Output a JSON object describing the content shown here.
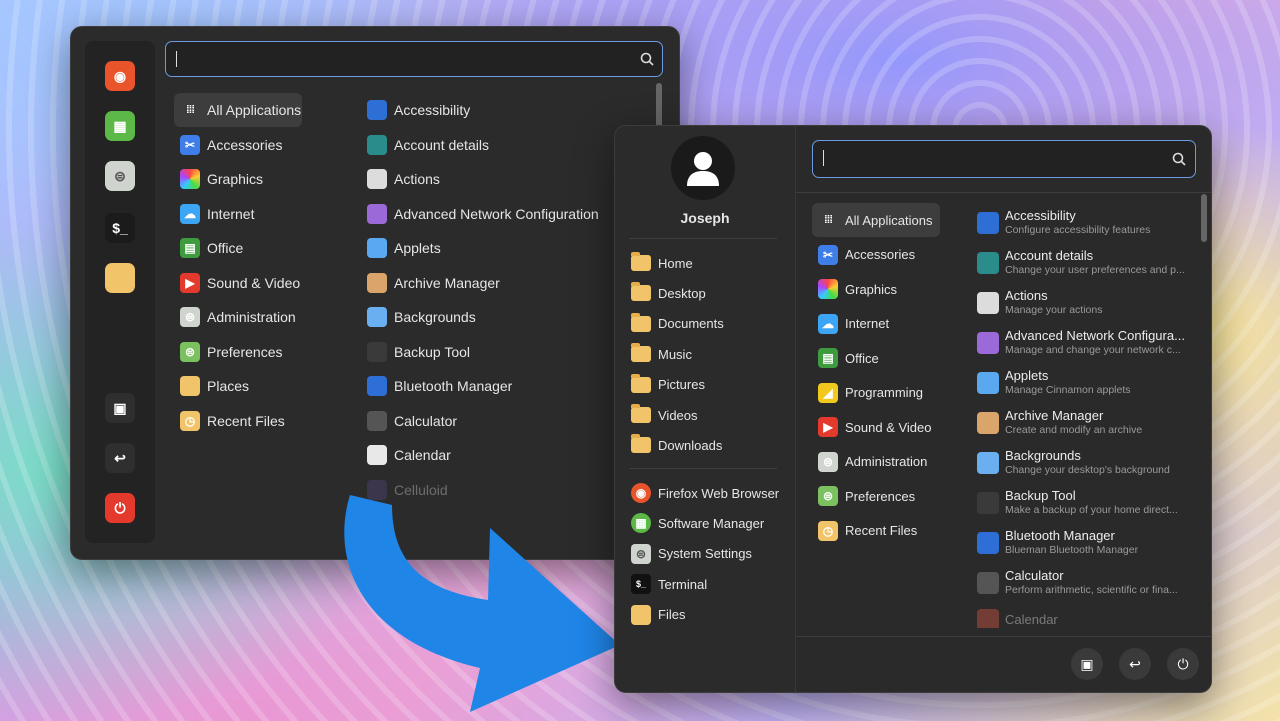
{
  "left_window": {
    "search": {
      "placeholder": ""
    },
    "dock": [
      {
        "name": "firefox-icon",
        "color": "#e9542a"
      },
      {
        "name": "software-manager-icon",
        "color": "#5cb947"
      },
      {
        "name": "settings-toggle-icon",
        "color": "#cfd4cf"
      },
      {
        "name": "terminal-icon",
        "color": "#1b1b1b"
      },
      {
        "name": "folder-icon",
        "color": "#f2c46a"
      },
      {
        "name": "lock-icon",
        "color": "#2f2f2f"
      },
      {
        "name": "logout-icon",
        "color": "#2f2f2f"
      },
      {
        "name": "power-icon",
        "color": "#e33a2d"
      }
    ],
    "categories": [
      {
        "label": "All Applications",
        "icon": "grid-icon"
      },
      {
        "label": "Accessories",
        "icon": "scissors-icon",
        "color": "#3f7ee8"
      },
      {
        "label": "Graphics",
        "icon": "palette-icon",
        "color": "#c94fd8"
      },
      {
        "label": "Internet",
        "icon": "cloud-icon",
        "color": "#3da5f5"
      },
      {
        "label": "Office",
        "icon": "office-icon",
        "color": "#3e9b3e"
      },
      {
        "label": "Sound & Video",
        "icon": "play-icon",
        "color": "#e33a2d"
      },
      {
        "label": "Administration",
        "icon": "toggle-icon",
        "color": "#cfd4cf"
      },
      {
        "label": "Preferences",
        "icon": "preferences-icon",
        "color": "#7cc160"
      },
      {
        "label": "Places",
        "icon": "folder-icon",
        "color": "#f2c46a"
      },
      {
        "label": "Recent Files",
        "icon": "recent-icon",
        "color": "#f2c46a"
      }
    ],
    "apps": [
      {
        "label": "Accessibility",
        "color": "#2e6fd6"
      },
      {
        "label": "Account details",
        "color": "#2b8c8c"
      },
      {
        "label": "Actions",
        "color": "#dcdcdc"
      },
      {
        "label": "Advanced Network Configuration",
        "color": "#9c6ad8"
      },
      {
        "label": "Applets",
        "color": "#5aa8f0"
      },
      {
        "label": "Archive Manager",
        "color": "#d9a56b"
      },
      {
        "label": "Backgrounds",
        "color": "#6ab0f0"
      },
      {
        "label": "Backup Tool",
        "color": "#3a3a3a"
      },
      {
        "label": "Bluetooth Manager",
        "color": "#2d6fd6"
      },
      {
        "label": "Calculator",
        "color": "#555555"
      },
      {
        "label": "Calendar",
        "color": "#e8e8e8"
      },
      {
        "label": "Celluloid",
        "color": "#5a4a8a"
      }
    ]
  },
  "right_window": {
    "user_name": "Joseph",
    "search": {
      "placeholder": ""
    },
    "places": [
      {
        "label": "Home"
      },
      {
        "label": "Desktop"
      },
      {
        "label": "Documents"
      },
      {
        "label": "Music"
      },
      {
        "label": "Pictures"
      },
      {
        "label": "Videos"
      },
      {
        "label": "Downloads"
      }
    ],
    "favorites": [
      {
        "label": "Firefox Web Browser",
        "icon": "firefox-icon",
        "color": "#e9542a"
      },
      {
        "label": "Software Manager",
        "icon": "software-manager-icon",
        "color": "#5cb947"
      },
      {
        "label": "System Settings",
        "icon": "settings-icon",
        "color": "#cfd4cf"
      },
      {
        "label": "Terminal",
        "icon": "terminal-icon",
        "color": "#111111"
      },
      {
        "label": "Files",
        "icon": "folder-icon",
        "color": "#f2c46a"
      }
    ],
    "categories": [
      {
        "label": "All Applications",
        "icon": "grid-icon"
      },
      {
        "label": "Accessories",
        "icon": "scissors-icon",
        "color": "#3f7ee8"
      },
      {
        "label": "Graphics",
        "icon": "palette-icon",
        "color": "#c94fd8"
      },
      {
        "label": "Internet",
        "icon": "cloud-icon",
        "color": "#3da5f5"
      },
      {
        "label": "Office",
        "icon": "office-icon",
        "color": "#3e9b3e"
      },
      {
        "label": "Programming",
        "icon": "programming-icon",
        "color": "#f2c81e"
      },
      {
        "label": "Sound & Video",
        "icon": "play-icon",
        "color": "#e33a2d"
      },
      {
        "label": "Administration",
        "icon": "toggle-icon",
        "color": "#cfd4cf"
      },
      {
        "label": "Preferences",
        "icon": "preferences-icon",
        "color": "#7cc160"
      },
      {
        "label": "Recent Files",
        "icon": "recent-icon",
        "color": "#f2c46a"
      }
    ],
    "apps": [
      {
        "label": "Accessibility",
        "desc": "Configure accessibility features",
        "color": "#2e6fd6"
      },
      {
        "label": "Account details",
        "desc": "Change your user preferences and p...",
        "color": "#2b8c8c"
      },
      {
        "label": "Actions",
        "desc": "Manage your actions",
        "color": "#dcdcdc"
      },
      {
        "label": "Advanced Network Configura...",
        "desc": "Manage and change your network c...",
        "color": "#9c6ad8"
      },
      {
        "label": "Applets",
        "desc": "Manage Cinnamon applets",
        "color": "#5aa8f0"
      },
      {
        "label": "Archive Manager",
        "desc": "Create and modify an archive",
        "color": "#d9a56b"
      },
      {
        "label": "Backgrounds",
        "desc": "Change your desktop's background",
        "color": "#6ab0f0"
      },
      {
        "label": "Backup Tool",
        "desc": "Make a backup of your home direct...",
        "color": "#3a3a3a"
      },
      {
        "label": "Bluetooth Manager",
        "desc": "Blueman Bluetooth Manager",
        "color": "#2d6fd6"
      },
      {
        "label": "Calculator",
        "desc": "Perform arithmetic, scientific or fina...",
        "color": "#555555"
      },
      {
        "label": "Calendar",
        "desc": "",
        "color": "#e05a4a"
      }
    ],
    "power_buttons": [
      {
        "name": "lock-icon"
      },
      {
        "name": "logout-icon"
      },
      {
        "name": "power-icon"
      }
    ]
  },
  "accent_color": "#6b9be0",
  "arrow_color": "#1f86e8"
}
